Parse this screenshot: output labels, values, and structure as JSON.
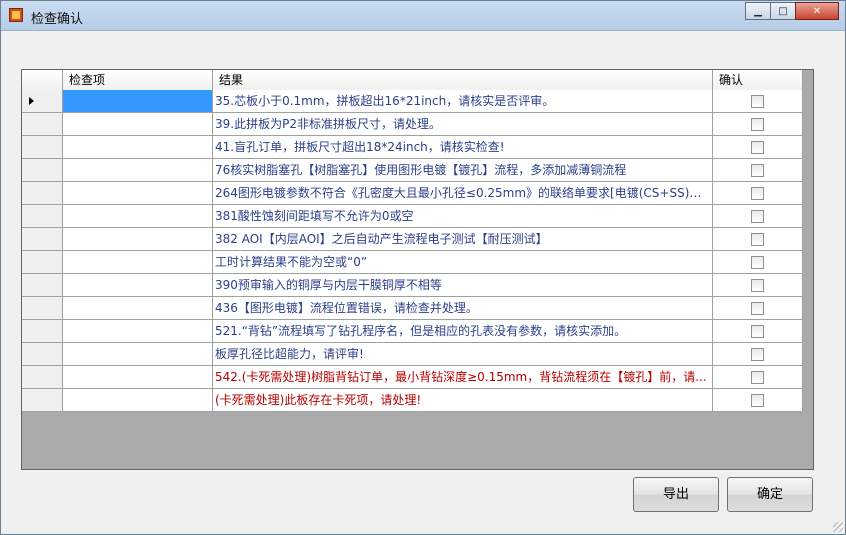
{
  "window": {
    "title": "检查确认"
  },
  "grid": {
    "columns": [
      "检查项",
      "结果",
      "确认"
    ],
    "rows": [
      {
        "item": "",
        "result": "35.芯板小于0.1mm，拼板超出16*21inch，请核实是否评审。",
        "checked": false,
        "current": true,
        "red": false
      },
      {
        "item": "",
        "result": "39.此拼板为P2非标准拼板尺寸，请处理。",
        "checked": false,
        "current": false,
        "red": false
      },
      {
        "item": "",
        "result": "41.盲孔订单，拼板尺寸超出18*24inch，请核实检查!",
        "checked": false,
        "current": false,
        "red": false
      },
      {
        "item": "",
        "result": "76核实树脂塞孔【树脂塞孔】使用图形电镀【镀孔】流程，多添加减薄铜流程",
        "checked": false,
        "current": false,
        "red": false
      },
      {
        "item": "",
        "result": "264图形电镀参数不符合《孔密度大且最小孔径≤0.25mm》的联络单要求[电镀(CS+SS)密度...",
        "checked": false,
        "current": false,
        "red": false
      },
      {
        "item": "",
        "result": "381酸性蚀刻间距填写不允许为0或空",
        "checked": false,
        "current": false,
        "red": false
      },
      {
        "item": "",
        "result": "382 AOI【内层AOI】之后自动产生流程电子测试【耐压测试】",
        "checked": false,
        "current": false,
        "red": false
      },
      {
        "item": "",
        "result": "工时计算结果不能为空或“0”",
        "checked": false,
        "current": false,
        "red": false
      },
      {
        "item": "",
        "result": "390预审输入的铜厚与内层干膜铜厚不相等",
        "checked": false,
        "current": false,
        "red": false
      },
      {
        "item": "",
        "result": "436【图形电镀】流程位置错误，请检查并处理。",
        "checked": false,
        "current": false,
        "red": false
      },
      {
        "item": "",
        "result": "521.“背钻”流程填写了钻孔程序名，但是相应的孔表没有参数，请核实添加。",
        "checked": false,
        "current": false,
        "red": false
      },
      {
        "item": "",
        "result": "板厚孔径比超能力，请评审!",
        "checked": false,
        "current": false,
        "red": false
      },
      {
        "item": "",
        "result": "542.(卡死需处理)树脂背钻订单，最小背钻深度≥0.15mm，背钻流程须在【镀孔】前，请...",
        "checked": false,
        "current": false,
        "red": true
      },
      {
        "item": "",
        "result": "(卡死需处理)此板存在卡死项，请处理!",
        "checked": false,
        "current": false,
        "red": true
      }
    ]
  },
  "buttons": {
    "export": "导出",
    "confirm": "确定"
  },
  "colors": {
    "selection": "#3399ff",
    "result_text": "#2c3f8a",
    "error_text": "#b60000"
  }
}
